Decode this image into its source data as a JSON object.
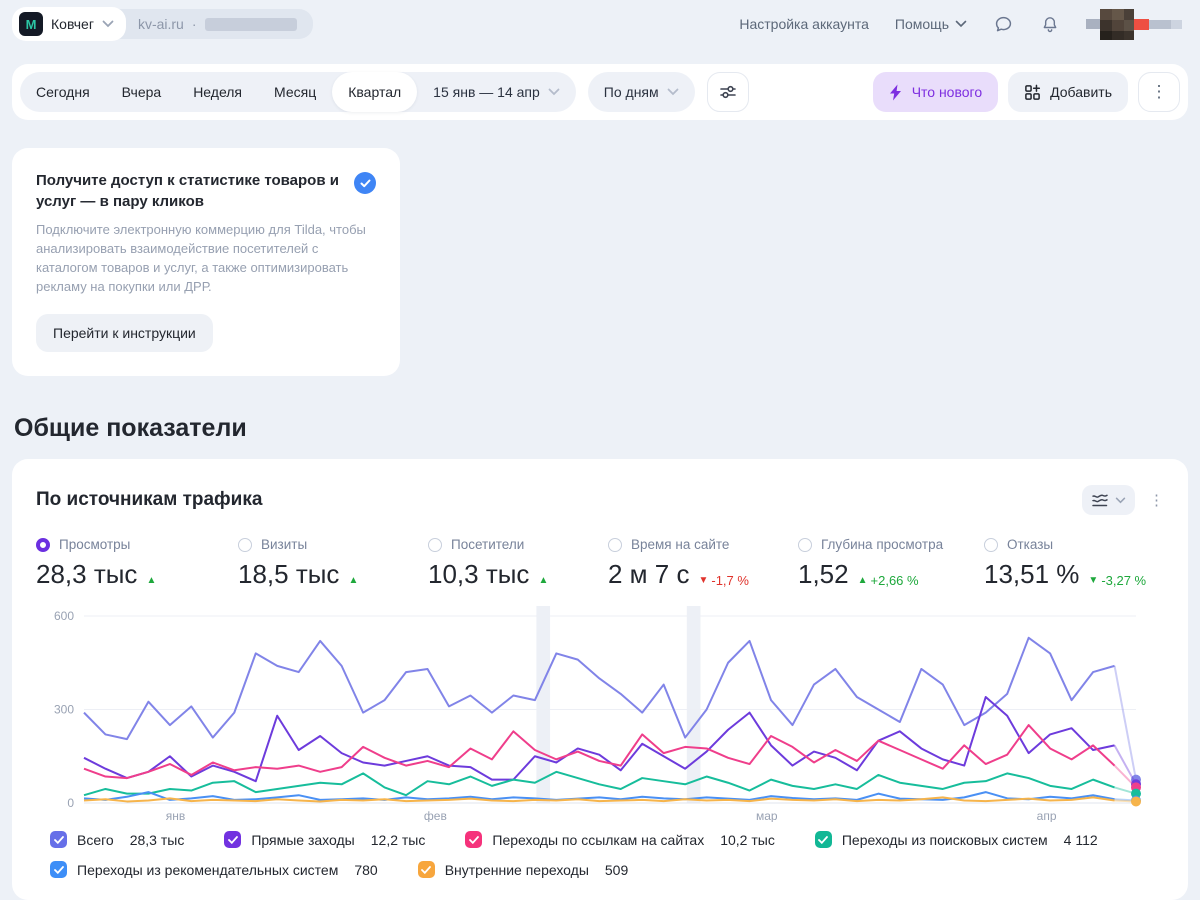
{
  "header": {
    "counter_name": "Ковчег",
    "logo_letter": "M",
    "counter_site": "kv-ai.ru",
    "separator": "·",
    "account_settings": "Настройка аккаунта",
    "help": "Помощь"
  },
  "toolbar": {
    "periods": [
      {
        "label": "Сегодня"
      },
      {
        "label": "Вчера"
      },
      {
        "label": "Неделя"
      },
      {
        "label": "Месяц"
      },
      {
        "label": "Квартал"
      }
    ],
    "selected_period": "Квартал",
    "date_range": "15 янв — 14 апр",
    "granularity": "По дням",
    "whats_new_label": "Что нового",
    "add_label": "Добавить"
  },
  "promo": {
    "title": "Получите доступ к статистике товаров и услуг — в пару кликов",
    "body": "Подключите электронную коммерцию для Tilda, чтобы анализировать взаимодействие посетителей с каталогом товаров и услуг, а также оптимизировать рекламу на покупки или ДРР.",
    "cta": "Перейти к инструкции"
  },
  "section_title": "Общие показатели",
  "widget": {
    "title": "По источникам трафика",
    "metrics": [
      {
        "label": "Просмотры",
        "value": "28,3 тыс",
        "arrow": "▲",
        "delta": ""
      },
      {
        "label": "Визиты",
        "value": "18,5 тыс",
        "arrow": "▲",
        "delta": ""
      },
      {
        "label": "Посетители",
        "value": "10,3 тыс",
        "arrow": "▲",
        "delta": ""
      },
      {
        "label": "Время на сайте",
        "value": "2 м 7 с",
        "arrow": "▼",
        "delta": "-1,7 %"
      },
      {
        "label": "Глубина просмотра",
        "value": "1,52",
        "arrow": "▲",
        "delta": "+2,66 %"
      },
      {
        "label": "Отказы",
        "value": "13,51 %",
        "arrow": "▼",
        "delta": "-3,27 %"
      }
    ],
    "legend": [
      {
        "label": "Всего",
        "value": "28,3 тыс",
        "color": "#666fe8"
      },
      {
        "label": "Прямые заходы",
        "value": "12,2 тыс",
        "color": "#7232e0"
      },
      {
        "label": "Переходы по ссылкам на сайтах",
        "value": "10,2 тыс",
        "color": "#f5327b"
      },
      {
        "label": "Переходы из поисковых систем",
        "value": "4 112",
        "color": "#12b795"
      },
      {
        "label": "Переходы из рекомендательных систем",
        "value": "780",
        "color": "#3d8ef7"
      },
      {
        "label": "Внутренние переходы",
        "value": "509",
        "color": "#f7a63d"
      }
    ]
  },
  "chart_data": {
    "type": "line",
    "title": "По источникам трафика",
    "x_range_label": "15 янв — 14 апр",
    "granularity": "По дням",
    "ylim": [
      0,
      600
    ],
    "yticks": [
      0,
      300,
      600
    ],
    "grid": true,
    "legend_position": "bottom",
    "x_labels": [
      {
        "label": "янв",
        "pos": 0.087
      },
      {
        "label": "фев",
        "pos": 0.334
      },
      {
        "label": "мар",
        "pos": 0.649
      },
      {
        "label": "апр",
        "pos": 0.915
      }
    ],
    "highlight_bands": [
      {
        "from": 0.43,
        "to": 0.443
      },
      {
        "from": 0.573,
        "to": 0.586
      }
    ],
    "series": [
      {
        "name": "Всего",
        "total": "28,3 тыс",
        "color": "#8184e8",
        "values": [
          290,
          220,
          205,
          325,
          250,
          310,
          210,
          290,
          480,
          440,
          420,
          520,
          440,
          290,
          330,
          420,
          430,
          310,
          345,
          290,
          345,
          330,
          480,
          460,
          400,
          350,
          290,
          380,
          210,
          300,
          450,
          520,
          330,
          250,
          380,
          430,
          340,
          300,
          260,
          430,
          380,
          250,
          290,
          350,
          530,
          480,
          330,
          420,
          440,
          75
        ]
      },
      {
        "name": "Прямые заходы",
        "total": "12,2 тыс",
        "color": "#6d3bdc",
        "values": [
          145,
          110,
          80,
          100,
          150,
          85,
          120,
          100,
          70,
          280,
          170,
          215,
          160,
          130,
          120,
          135,
          150,
          120,
          115,
          75,
          75,
          150,
          130,
          175,
          155,
          105,
          190,
          150,
          110,
          165,
          235,
          290,
          185,
          120,
          165,
          145,
          105,
          200,
          230,
          175,
          140,
          120,
          340,
          280,
          160,
          220,
          240,
          170,
          185,
          60
        ]
      },
      {
        "name": "Переходы по ссылкам на сайтах",
        "total": "10,2 тыс",
        "color": "#ef3e8b",
        "values": [
          110,
          85,
          80,
          100,
          125,
          90,
          130,
          105,
          115,
          110,
          120,
          100,
          115,
          180,
          145,
          120,
          135,
          115,
          175,
          140,
          230,
          170,
          140,
          165,
          135,
          120,
          220,
          160,
          180,
          175,
          145,
          125,
          215,
          180,
          130,
          170,
          135,
          200,
          170,
          140,
          110,
          185,
          125,
          155,
          250,
          175,
          140,
          185,
          120,
          50
        ]
      },
      {
        "name": "Переходы из поисковых систем",
        "total": "4 112",
        "color": "#17bd9b",
        "values": [
          25,
          45,
          30,
          30,
          45,
          40,
          65,
          70,
          35,
          45,
          55,
          65,
          60,
          95,
          50,
          25,
          70,
          60,
          85,
          55,
          75,
          65,
          100,
          80,
          60,
          45,
          80,
          70,
          60,
          85,
          65,
          40,
          75,
          55,
          45,
          60,
          45,
          90,
          65,
          55,
          45,
          65,
          70,
          95,
          80,
          55,
          45,
          75,
          50,
          30
        ]
      },
      {
        "name": "Переходы из рекомендательных систем",
        "total": "780",
        "color": "#4a90f4",
        "values": [
          15,
          10,
          20,
          35,
          10,
          15,
          22,
          10,
          12,
          18,
          25,
          10,
          12,
          15,
          10,
          18,
          12,
          15,
          20,
          12,
          18,
          15,
          10,
          14,
          18,
          12,
          20,
          15,
          12,
          18,
          14,
          10,
          22,
          16,
          12,
          15,
          10,
          30,
          14,
          12,
          10,
          18,
          35,
          15,
          12,
          20,
          15,
          25,
          12,
          8
        ]
      },
      {
        "name": "Внутренние переходы",
        "total": "509",
        "color": "#f6b44b",
        "values": [
          8,
          12,
          5,
          8,
          15,
          6,
          10,
          8,
          6,
          12,
          8,
          5,
          10,
          8,
          12,
          6,
          8,
          10,
          14,
          8,
          6,
          10,
          8,
          12,
          6,
          8,
          10,
          6,
          12,
          8,
          10,
          6,
          14,
          10,
          8,
          12,
          6,
          10,
          8,
          12,
          18,
          8,
          6,
          10,
          14,
          8,
          10,
          18,
          8,
          5
        ]
      }
    ]
  }
}
